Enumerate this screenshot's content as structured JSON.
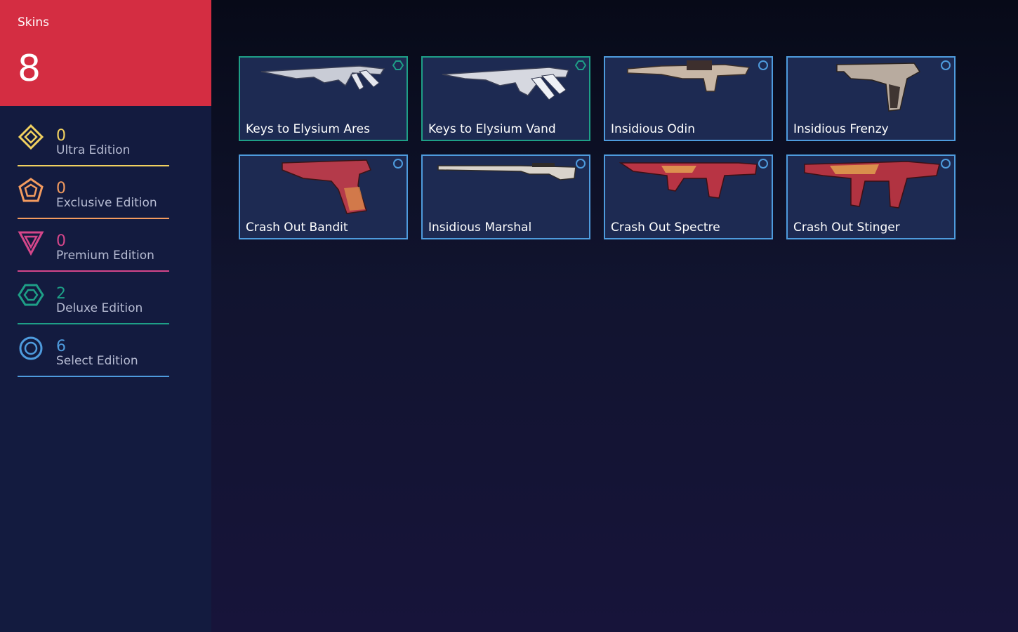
{
  "summary": {
    "label": "Skins",
    "total": "8"
  },
  "tiers": [
    {
      "name": "Ultra Edition",
      "count": "0",
      "color": "#f1d160",
      "icon": "diamond-icon"
    },
    {
      "name": "Exclusive Edition",
      "count": "0",
      "color": "#f39b5f",
      "icon": "pentagon-icon"
    },
    {
      "name": "Premium Edition",
      "count": "0",
      "color": "#d4468a",
      "icon": "triangle-icon"
    },
    {
      "name": "Deluxe Edition",
      "count": "2",
      "color": "#1e9f87",
      "icon": "hexagon-icon"
    },
    {
      "name": "Select Edition",
      "count": "6",
      "color": "#4e9bdd",
      "icon": "circle-icon"
    }
  ],
  "skins": [
    {
      "name": "Keys to Elysium Ares",
      "tier": "deluxe",
      "color": "#1e9f87",
      "weapon_icon": "machine-gun-icon"
    },
    {
      "name": "Keys to Elysium Vand",
      "tier": "deluxe",
      "color": "#1e9f87",
      "weapon_icon": "rifle-icon"
    },
    {
      "name": "Insidious Odin",
      "tier": "select",
      "color": "#4e9bdd",
      "weapon_icon": "heavy-gun-icon"
    },
    {
      "name": "Insidious Frenzy",
      "tier": "select",
      "color": "#4e9bdd",
      "weapon_icon": "pistol-icon"
    },
    {
      "name": "Crash Out Bandit",
      "tier": "select",
      "color": "#4e9bdd",
      "weapon_icon": "pistol-icon"
    },
    {
      "name": "Insidious Marshal",
      "tier": "select",
      "color": "#4e9bdd",
      "weapon_icon": "sniper-icon"
    },
    {
      "name": "Crash Out Spectre",
      "tier": "select",
      "color": "#4e9bdd",
      "weapon_icon": "smg-icon"
    },
    {
      "name": "Crash Out Stinger",
      "tier": "select",
      "color": "#4e9bdd",
      "weapon_icon": "smg-icon"
    }
  ]
}
